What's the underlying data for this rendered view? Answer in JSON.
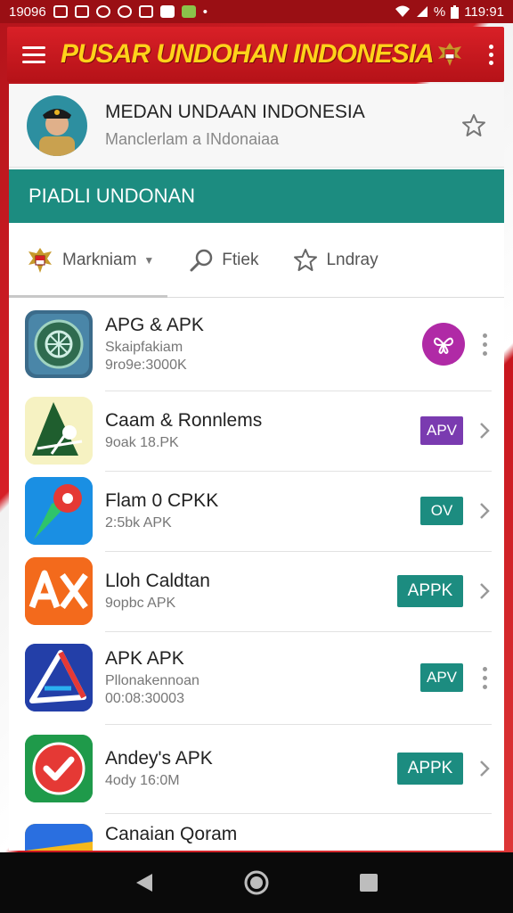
{
  "status_bar": {
    "left_text": "19096",
    "right_text": "119:91",
    "percent_glyph": "%"
  },
  "app_bar": {
    "title": "PUSAR UNDOHAN INDONESIA"
  },
  "profile": {
    "name": "MEDAN UNDAAN INDONESIA",
    "subtitle": "Manclerlam a INdonaiaa"
  },
  "banner": {
    "label": "PIADLI UNDONAN"
  },
  "tabs": [
    {
      "label": "Markniam",
      "icon": "emblem-icon"
    },
    {
      "label": "Ftiek",
      "icon": "search-icon"
    },
    {
      "label": "Lndray",
      "icon": "star-icon"
    }
  ],
  "items": [
    {
      "title": "APG & APK",
      "sub": "Skaipfakiam",
      "sub2": "9ro9e:3000K",
      "badge": "",
      "action": "menu",
      "icon_name": "wheel-app-icon"
    },
    {
      "title": "Caam & Ronnlems",
      "sub": "9oak 18.PK",
      "sub2": "",
      "badge": "APV",
      "action": "chevron",
      "icon_name": "tree-app-icon"
    },
    {
      "title": "Flam 0 CPKK",
      "sub": "2:5bk APK",
      "sub2": "",
      "badge": "OV",
      "action": "chevron",
      "icon_name": "pin-app-icon"
    },
    {
      "title": "Lloh Caldtan",
      "sub": "9opbc APK",
      "sub2": "",
      "badge": "APPK",
      "action": "chevron",
      "icon_name": "ax-app-icon"
    },
    {
      "title": "APK APK",
      "sub": "Pllonakennoan",
      "sub2": "00:08:30003",
      "badge": "APV",
      "action": "menu",
      "icon_name": "arrow-app-icon"
    },
    {
      "title": "Andey's APK",
      "sub": "4ody 16:0M",
      "sub2": "",
      "badge": "APPK",
      "action": "chevron",
      "icon_name": "check-app-icon"
    },
    {
      "title": "Canaian Qoram",
      "sub": "",
      "sub2": "",
      "badge": "",
      "action": "",
      "icon_name": "partial-app-icon"
    }
  ],
  "colors": {
    "primary_red": "#d61f26",
    "title_yellow": "#ffd21a",
    "teal": "#1c8c80",
    "purple_badge": "#7a3bb0",
    "magenta_circle": "#b02aa6"
  }
}
